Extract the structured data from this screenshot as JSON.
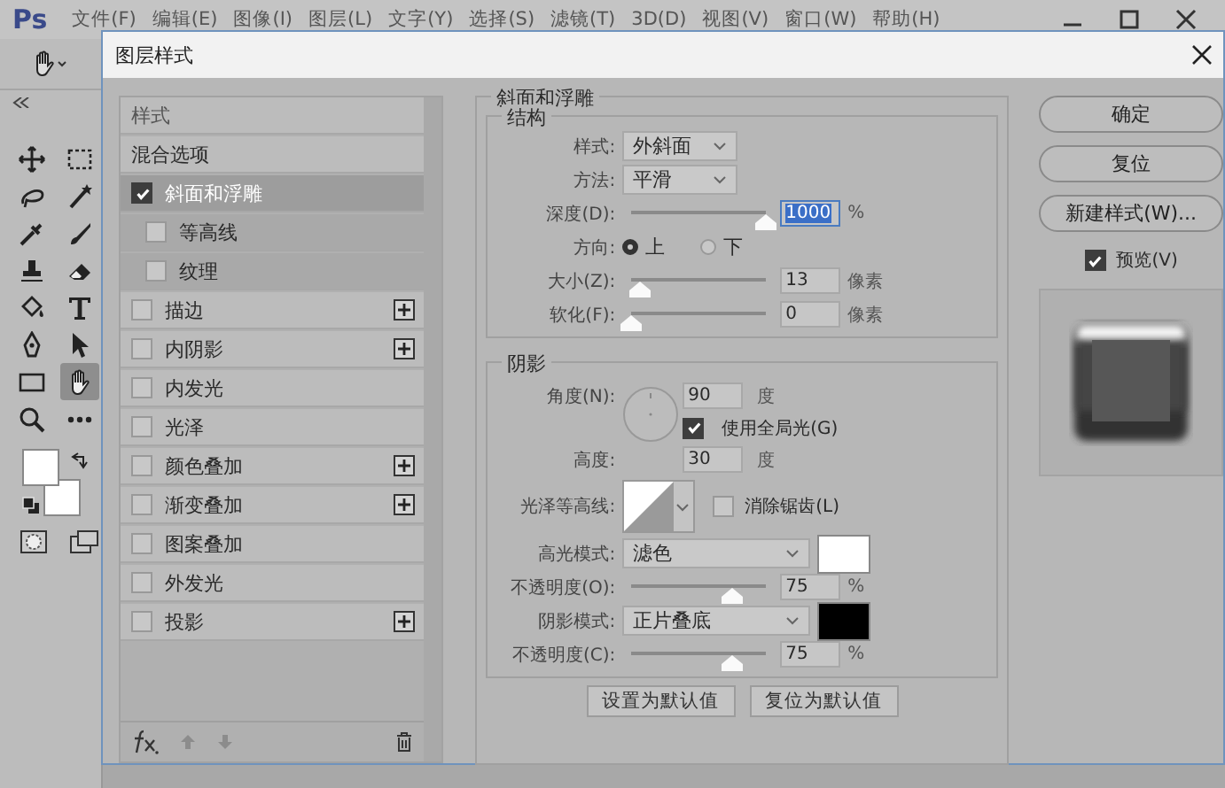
{
  "app": {
    "logo": "Ps",
    "menu": [
      "文件(F)",
      "编辑(E)",
      "图像(I)",
      "图层(L)",
      "文字(Y)",
      "选择(S)",
      "滤镜(T)",
      "3D(D)",
      "视图(V)",
      "窗口(W)",
      "帮助(H)"
    ]
  },
  "tools": [
    {
      "kind": "move",
      "selected": false
    },
    {
      "kind": "marquee",
      "selected": false
    },
    {
      "kind": "lasso",
      "selected": false
    },
    {
      "kind": "wand",
      "selected": false
    },
    {
      "kind": "eyedropper",
      "selected": false
    },
    {
      "kind": "brush",
      "selected": false
    },
    {
      "kind": "stamp",
      "selected": false
    },
    {
      "kind": "eraser",
      "selected": false
    },
    {
      "kind": "bucket",
      "selected": false
    },
    {
      "kind": "type",
      "selected": false
    },
    {
      "kind": "pen",
      "selected": false
    },
    {
      "kind": "arrow",
      "selected": false
    },
    {
      "kind": "rectangle",
      "selected": false
    },
    {
      "kind": "hand",
      "selected": true
    },
    {
      "kind": "zoom",
      "selected": false
    },
    {
      "kind": "more",
      "selected": false
    }
  ],
  "dialog": {
    "title": "图层样式",
    "styles": {
      "header": "样式",
      "items": [
        {
          "label": "混合选项",
          "kind": "plain",
          "selected": false
        },
        {
          "label": "斜面和浮雕",
          "kind": "effect",
          "checked": true,
          "selected": true,
          "addable": false,
          "children": [
            {
              "label": "等高线",
              "checked": false,
              "selected": false
            },
            {
              "label": "纹理",
              "checked": false,
              "selected": false
            }
          ]
        },
        {
          "label": "描边",
          "kind": "effect",
          "checked": false,
          "selected": false,
          "addable": true
        },
        {
          "label": "内阴影",
          "kind": "effect",
          "checked": false,
          "selected": false,
          "addable": true
        },
        {
          "label": "内发光",
          "kind": "effect",
          "checked": false,
          "selected": false,
          "addable": false
        },
        {
          "label": "光泽",
          "kind": "effect",
          "checked": false,
          "selected": false,
          "addable": false
        },
        {
          "label": "颜色叠加",
          "kind": "effect",
          "checked": false,
          "selected": false,
          "addable": true
        },
        {
          "label": "渐变叠加",
          "kind": "effect",
          "checked": false,
          "selected": false,
          "addable": true
        },
        {
          "label": "图案叠加",
          "kind": "effect",
          "checked": false,
          "selected": false,
          "addable": false
        },
        {
          "label": "外发光",
          "kind": "effect",
          "checked": false,
          "selected": false,
          "addable": false
        },
        {
          "label": "投影",
          "kind": "effect",
          "checked": false,
          "selected": false,
          "addable": true
        }
      ]
    },
    "bevel": {
      "title": "斜面和浮雕",
      "structure": {
        "title": "结构",
        "style": {
          "label": "样式:",
          "value": "外斜面"
        },
        "technique": {
          "label": "方法:",
          "value": "平滑"
        },
        "depth": {
          "label": "深度(D):",
          "level": 1,
          "value": "1000",
          "highlighted": true,
          "unit": "%"
        },
        "direction": {
          "label": "方向:",
          "options": [
            {
              "label": "上",
              "selected": true
            },
            {
              "label": "下",
              "selected": false
            }
          ]
        },
        "size": {
          "label": "大小(Z):",
          "level": 0.07,
          "value": "13",
          "highlighted": false,
          "unit": "像素"
        },
        "soften": {
          "label": "软化(F):",
          "level": 0,
          "value": "0",
          "highlighted": false,
          "unit": "像素"
        }
      },
      "shading": {
        "title": "阴影",
        "angle": {
          "label": "角度(N):",
          "value": "90",
          "unit": "度"
        },
        "global_light": {
          "label": "使用全局光(G)",
          "checked": true
        },
        "altitude": {
          "label": "高度:",
          "value": "30",
          "unit": "度"
        },
        "gloss_contour": {
          "label": "光泽等高线:"
        },
        "anti_aliased": {
          "label": "消除锯齿(L)",
          "checked": false
        },
        "highlight_mode": {
          "label": "高光模式:",
          "value": "滤色",
          "color": "#ffffff"
        },
        "highlight_opacity": {
          "label": "不透明度(O):",
          "level": 0.75,
          "value": "75",
          "highlighted": false,
          "unit": "%"
        },
        "shadow_mode": {
          "label": "阴影模式:",
          "value": "正片叠底",
          "color": "#000000"
        },
        "shadow_opacity": {
          "label": "不透明度(C):",
          "level": 0.75,
          "value": "75",
          "highlighted": false,
          "unit": "%"
        }
      },
      "buttons": [
        "设置为默认值",
        "复位为默认值"
      ]
    },
    "actions": [
      "确定",
      "复位",
      "新建样式(W)..."
    ],
    "preview": {
      "label": "预览(V)",
      "checked": true
    }
  }
}
